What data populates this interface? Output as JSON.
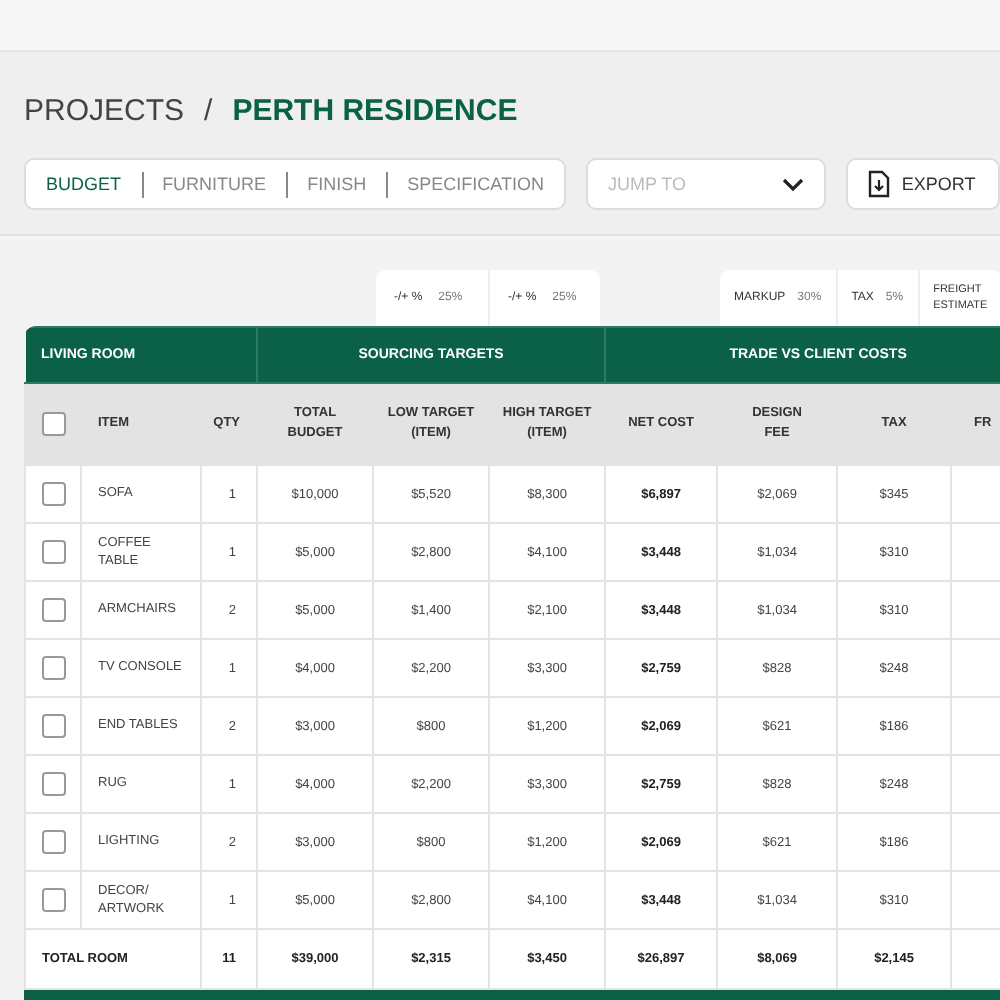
{
  "breadcrumb": {
    "parent": "PROJECTS",
    "separator": "/",
    "current": "PERTH RESIDENCE"
  },
  "tabs": [
    {
      "label": "BUDGET",
      "selected": true
    },
    {
      "label": "FURNITURE",
      "selected": false
    },
    {
      "label": "FINISH",
      "selected": false
    },
    {
      "label": "SPECIFICATION",
      "selected": false
    }
  ],
  "jump_to": {
    "placeholder": "JUMP TO"
  },
  "export_button": "EXPORT",
  "adjusters": [
    {
      "label": "-/+ %",
      "value": "25%"
    },
    {
      "label": "-/+ %",
      "value": "25%"
    }
  ],
  "rates": [
    {
      "label": "MARKUP",
      "value": "30%"
    },
    {
      "label": "TAX",
      "value": "5%"
    },
    {
      "label": "FREIGHT ESTIMATE"
    }
  ],
  "table": {
    "groups": [
      "LIVING ROOM",
      "SOURCING TARGETS",
      "TRADE VS CLIENT COSTS"
    ],
    "all_checked": false,
    "columns": [
      "ITEM",
      "QTY",
      "TOTAL BUDGET",
      "LOW TARGET (ITEM)",
      "HIGH TARGET (ITEM)",
      "NET COST",
      "DESIGN FEE",
      "TAX",
      "FR"
    ],
    "rows": [
      {
        "checked": false,
        "cells": [
          "SOFA",
          "1",
          "$10,000",
          "$5,520",
          "$8,300",
          "$6,897",
          "$2,069",
          "$345"
        ]
      },
      {
        "checked": false,
        "cells": [
          "COFFEE TABLE",
          "1",
          "$5,000",
          "$2,800",
          "$4,100",
          "$3,448",
          "$1,034",
          "$310"
        ]
      },
      {
        "checked": false,
        "cells": [
          "ARMCHAIRS",
          "2",
          "$5,000",
          "$1,400",
          "$2,100",
          "$3,448",
          "$1,034",
          "$310"
        ]
      },
      {
        "checked": false,
        "cells": [
          "TV CONSOLE",
          "1",
          "$4,000",
          "$2,200",
          "$3,300",
          "$2,759",
          "$828",
          "$248"
        ]
      },
      {
        "checked": false,
        "cells": [
          "END TABLES",
          "2",
          "$3,000",
          "$800",
          "$1,200",
          "$2,069",
          "$621",
          "$186"
        ]
      },
      {
        "checked": false,
        "cells": [
          "RUG",
          "1",
          "$4,000",
          "$2,200",
          "$3,300",
          "$2,759",
          "$828",
          "$248"
        ]
      },
      {
        "checked": false,
        "cells": [
          "LIGHTING",
          "2",
          "$3,000",
          "$800",
          "$1,200",
          "$2,069",
          "$621",
          "$186"
        ]
      },
      {
        "checked": false,
        "cells": [
          "DECOR/ ARTWORK",
          "1",
          "$5,000",
          "$2,800",
          "$4,100",
          "$3,448",
          "$1,034",
          "$310"
        ]
      }
    ],
    "total": {
      "label": "TOTAL ROOM",
      "cells": [
        "11",
        "$39,000",
        "$2,315",
        "$3,450",
        "$26,897",
        "$8,069",
        "$2,145"
      ]
    }
  }
}
